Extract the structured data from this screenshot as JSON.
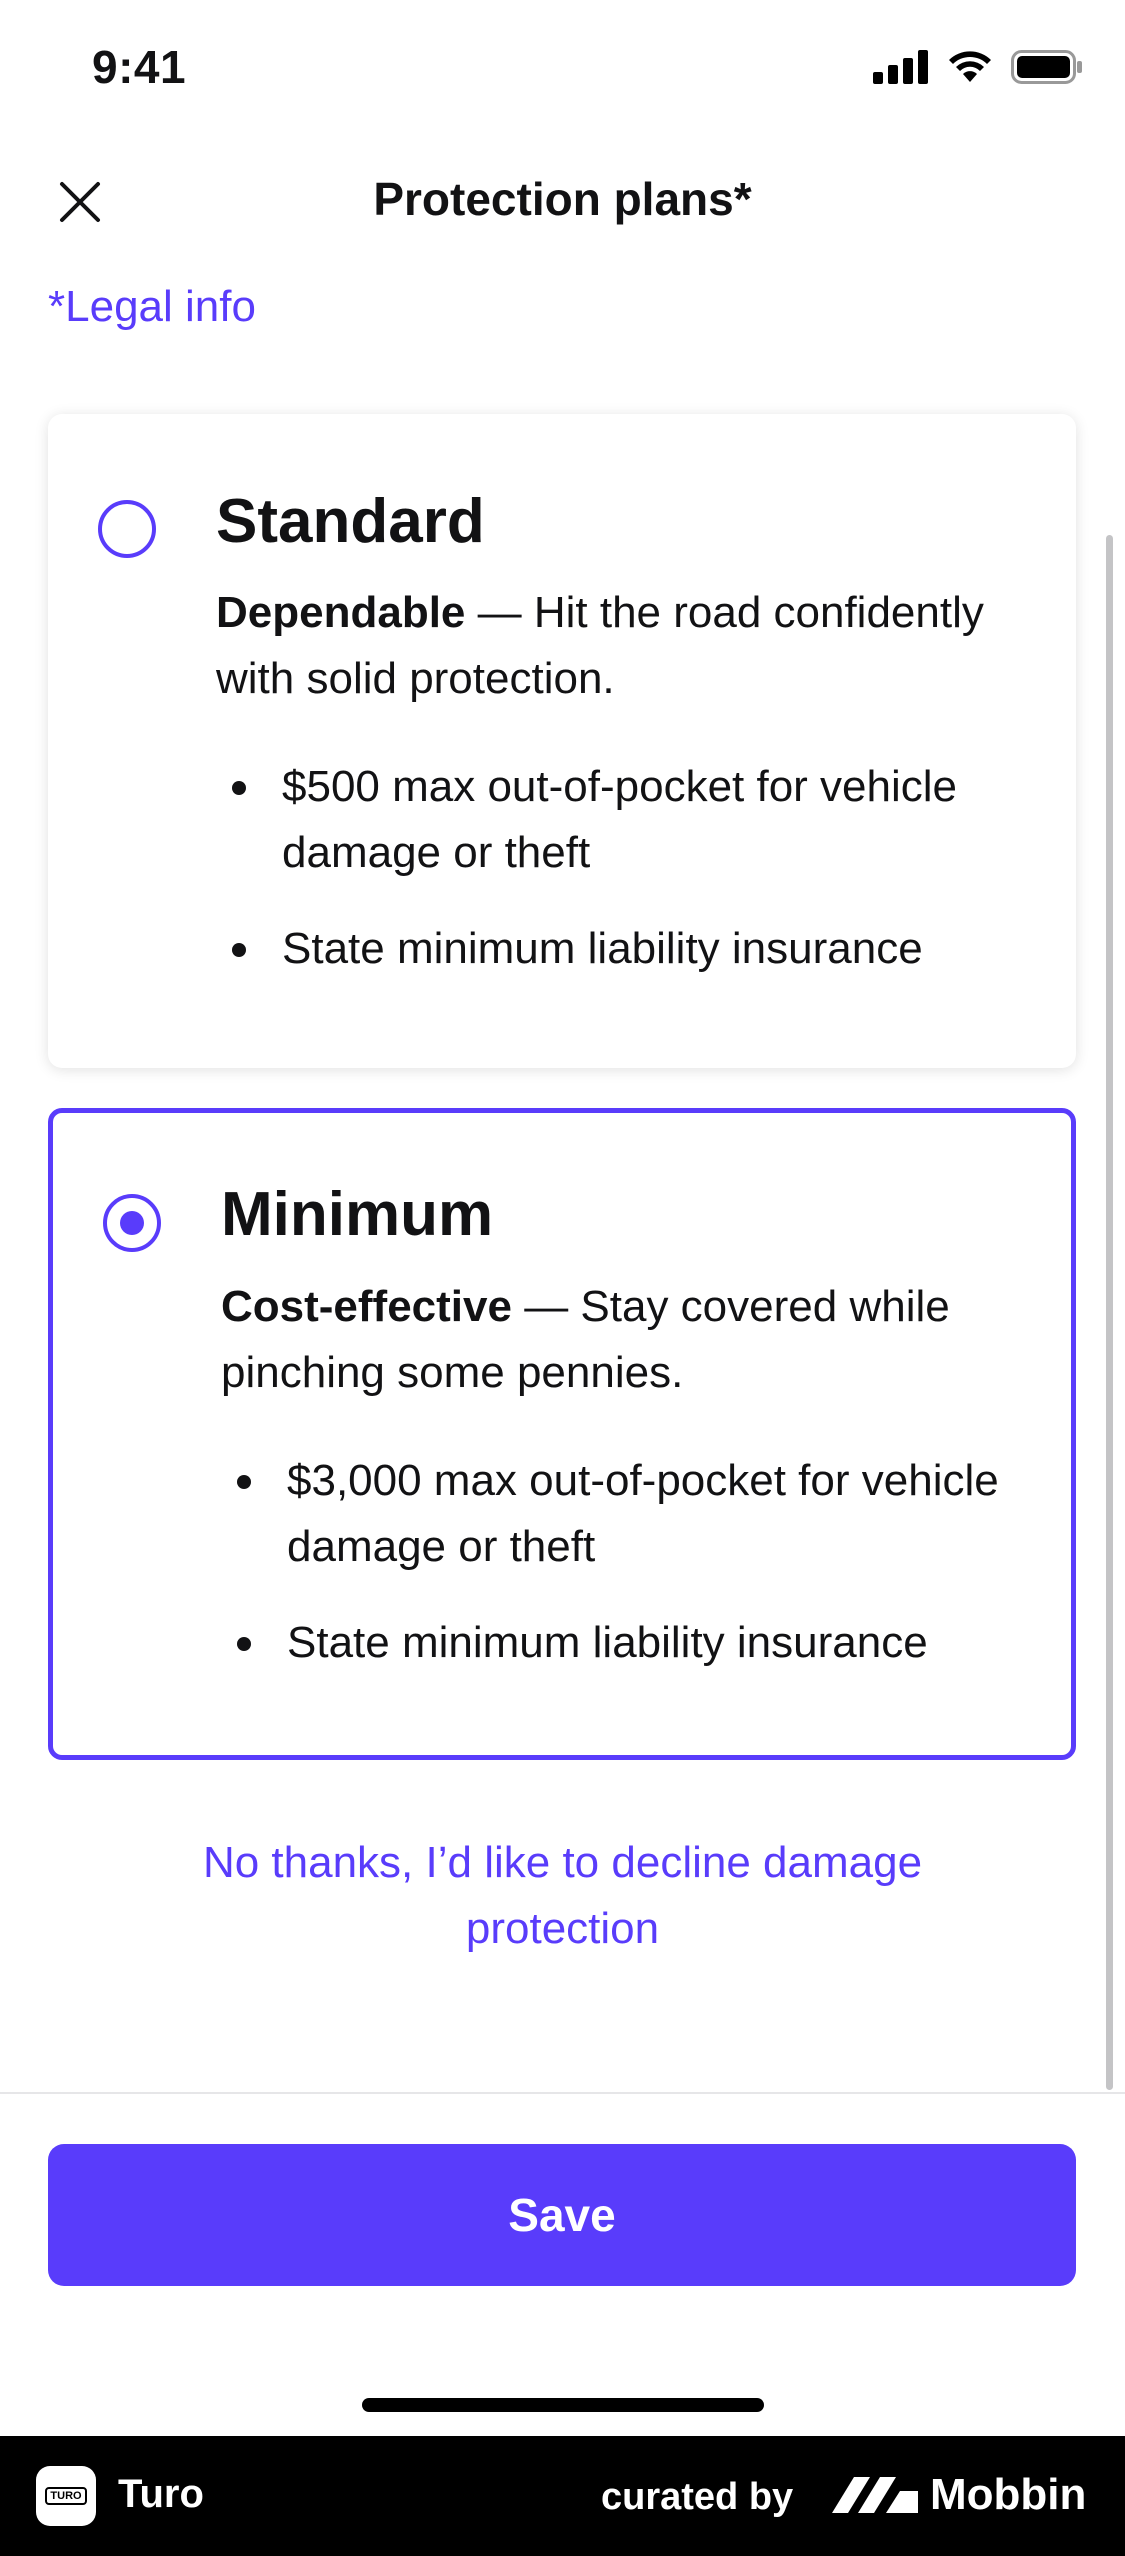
{
  "status_bar": {
    "time": "9:41"
  },
  "nav": {
    "title": "Protection plans*"
  },
  "legal_link": "*Legal info",
  "plans": [
    {
      "name": "Standard",
      "tagline": "Dependable",
      "description": " — Hit the road confidently with solid protection.",
      "bullets": [
        "$500 max out-of-pocket for vehicle damage or theft",
        "State minimum liability insurance"
      ],
      "selected": false
    },
    {
      "name": "Minimum",
      "tagline": "Cost-effective",
      "description": " — Stay covered while pinching some pennies.",
      "bullets": [
        "$3,000 max out-of-pocket for vehicle damage or theft",
        "State minimum liability insurance"
      ],
      "selected": true
    }
  ],
  "decline_link": "No thanks, I’d like to decline damage protection",
  "save_label": "Save",
  "footer": {
    "app_name": "Turo",
    "app_icon_text": "TURO",
    "curated_by": "curated by",
    "brand": "Mobbin"
  },
  "colors": {
    "accent": "#593CFB",
    "text": "#121214",
    "footer_bg": "#000000"
  }
}
